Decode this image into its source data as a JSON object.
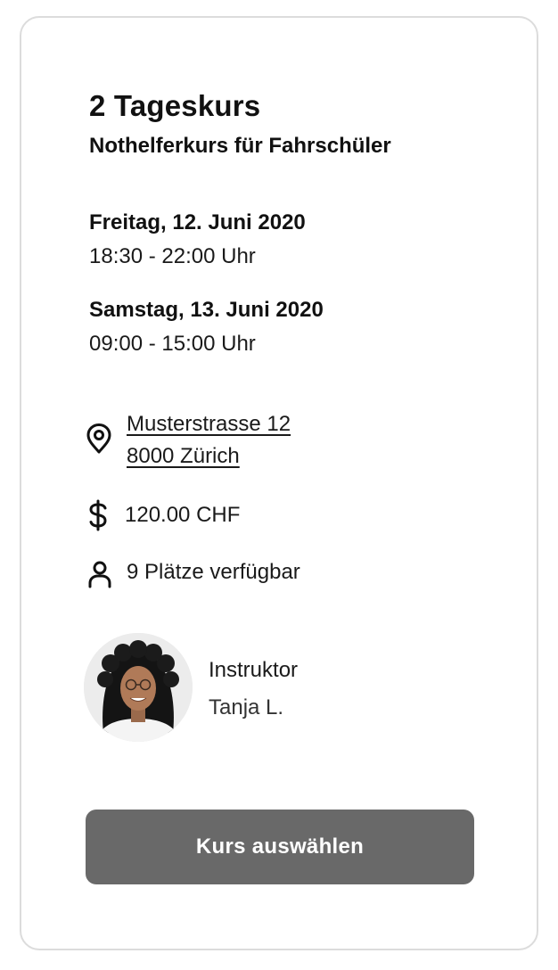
{
  "course": {
    "type": "2 Tageskurs",
    "name": "Nothelferkurs für Fahrschüler"
  },
  "schedule": [
    {
      "day": "Freitag, 12. Juni 2020",
      "time": "18:30 - 22:00 Uhr"
    },
    {
      "day": "Samstag, 13. Juni 2020",
      "time": "09:00 - 15:00 Uhr"
    }
  ],
  "location": {
    "icon": "map-pin-icon",
    "street": "Musterstrasse 12",
    "city": "8000 Zürich"
  },
  "price": {
    "icon": "dollar-icon",
    "value": "120.00 CHF"
  },
  "seats": {
    "icon": "user-icon",
    "text": "9 Plätze verfügbar"
  },
  "instructor": {
    "label": "Instruktor",
    "name": "Tanja L."
  },
  "button": {
    "label": "Kurs auswählen"
  },
  "colors": {
    "button_bg": "#696969",
    "button_text": "#ffffff",
    "card_border": "#dcdcdc"
  }
}
